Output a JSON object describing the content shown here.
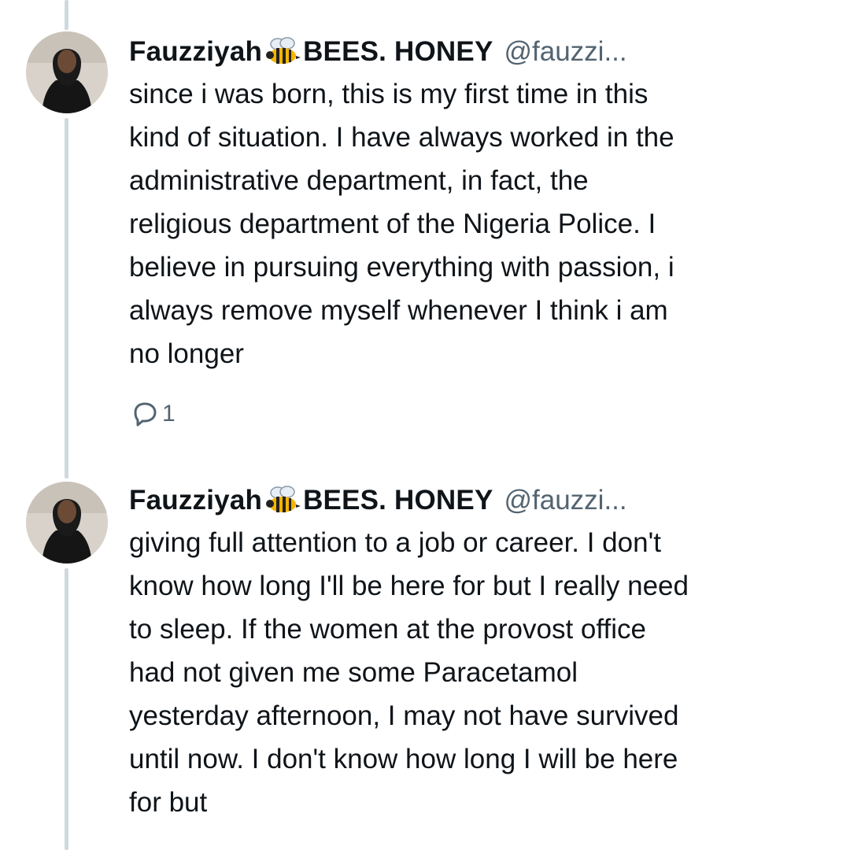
{
  "tweets": [
    {
      "display_name_part1": "Fauzziyah",
      "display_name_part2": "BEES. HONEY",
      "handle": "@fauzzi...",
      "text": "since i was born, this is my first time in this\nkind of situation. I have always worked in the\nadministrative department, in fact, the\nreligious department of the Nigeria Police. I\nbelieve in pursuing everything with passion, i\nalways remove myself whenever I think i am\nno longer",
      "reply_count": "1",
      "icons": [
        "avatar",
        "bee-icon",
        "reply-icon"
      ]
    },
    {
      "display_name_part1": "Fauzziyah",
      "display_name_part2": "BEES. HONEY",
      "handle": "@fauzzi...",
      "text": "giving full attention to a job or career. I don't\nknow how long I'll be here for but I really need\nto sleep. If the women at the provost office\nhad not given me some Paracetamol\nyesterday afternoon, I may not have survived\nuntil now. I don't know how long I will be here\nfor but",
      "icons": [
        "avatar",
        "bee-icon"
      ]
    }
  ],
  "colors": {
    "text": "#0f1419",
    "secondary": "#536471",
    "thread_line": "#cfd9de"
  }
}
